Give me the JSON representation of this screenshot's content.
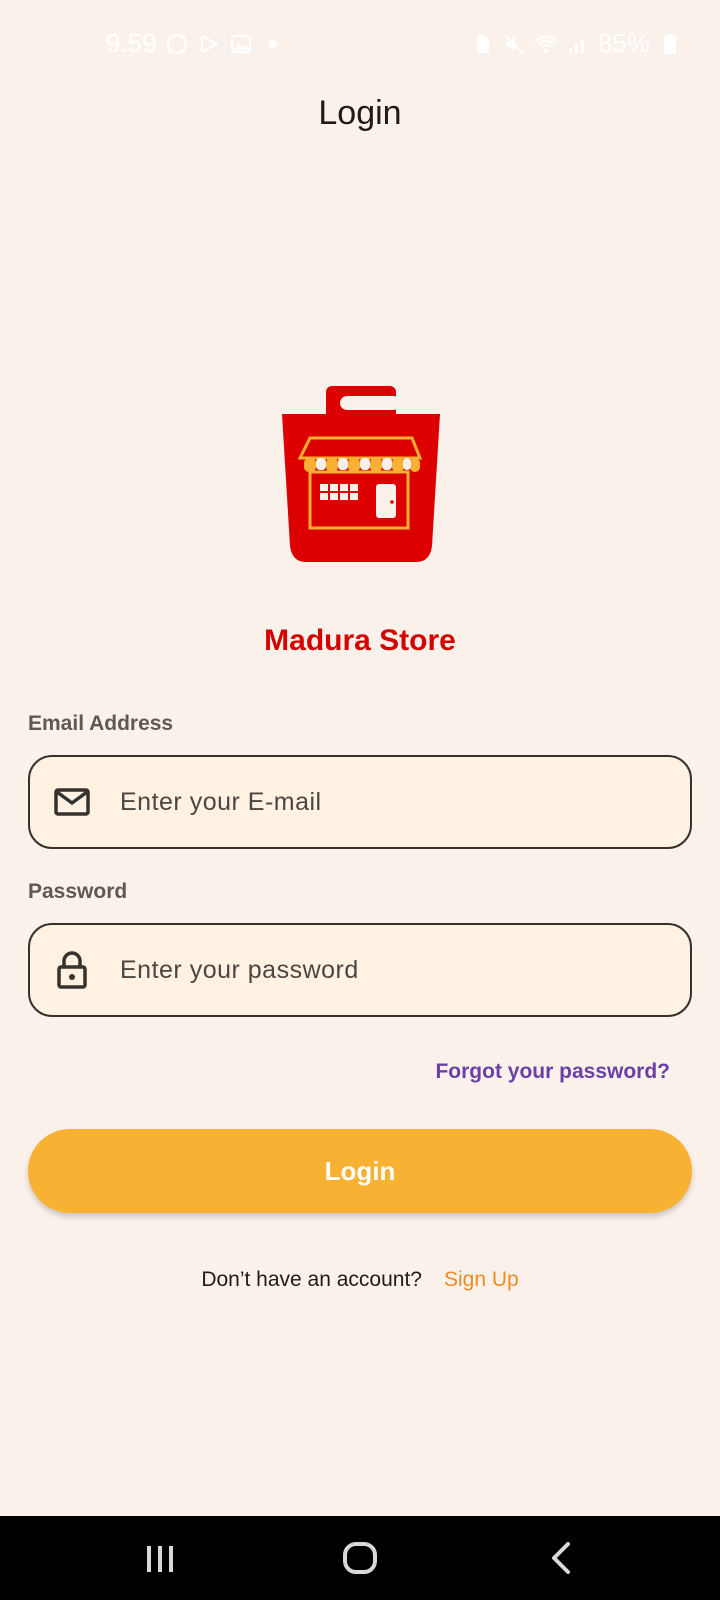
{
  "status_bar": {
    "time": "9.59",
    "battery": "85%",
    "icons_left": [
      "whatsapp-icon",
      "play-icon",
      "gallery-icon"
    ],
    "icons_right": [
      "sim-icon",
      "mute-icon",
      "wifi-icon",
      "signal-icon",
      "battery-icon"
    ]
  },
  "app_bar": {
    "title": "Login"
  },
  "brand": {
    "name": "Madura Store",
    "color": "#d50000"
  },
  "form": {
    "email": {
      "label": "Email Address",
      "placeholder": "Enter your E-mail",
      "value": ""
    },
    "password": {
      "label": "Password",
      "placeholder": "Enter your password",
      "value": ""
    },
    "forgot_label": "Forgot your password?",
    "login_label": "Login"
  },
  "signup": {
    "prompt": "Don’t have an account?",
    "link_label": "Sign Up"
  },
  "colors": {
    "background": "#faf2ea",
    "accent": "#f9b133",
    "link_purple": "#6a3fa8",
    "link_orange": "#f08a24"
  },
  "nav_bar": {
    "buttons": [
      "recents-icon",
      "home-icon",
      "back-icon"
    ]
  }
}
